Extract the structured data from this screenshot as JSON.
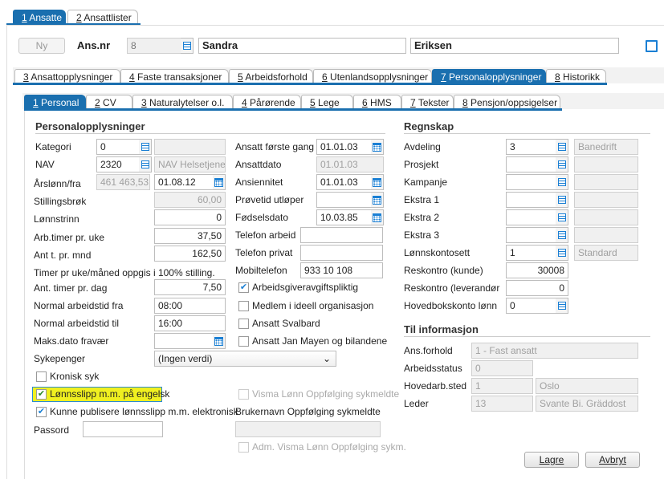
{
  "top_tabs": [
    {
      "num": "1",
      "label": "Ansatte",
      "active": true
    },
    {
      "num": "2",
      "label": "Ansattlister"
    }
  ],
  "header": {
    "new_label": "Ny",
    "ansnr_label": "Ans.nr",
    "ansnr": "8",
    "first_name": "Sandra",
    "last_name": "Eriksen"
  },
  "main_tabs": [
    {
      "num": "3",
      "label": "Ansattopplysninger"
    },
    {
      "num": "4",
      "label": "Faste transaksjoner"
    },
    {
      "num": "5",
      "label": "Arbeidsforhold"
    },
    {
      "num": "6",
      "label": "Utenlandsopplysninger"
    },
    {
      "num": "7",
      "label": "Personalopplysninger",
      "active": true
    },
    {
      "num": "8",
      "label": "Historikk"
    }
  ],
  "sub_tabs": [
    {
      "num": "1",
      "label": "Personal",
      "active": true
    },
    {
      "num": "2",
      "label": "CV"
    },
    {
      "num": "3",
      "label": "Naturalytelser o.l."
    },
    {
      "num": "4",
      "label": "Pårørende"
    },
    {
      "num": "5",
      "label": "Lege"
    },
    {
      "num": "6",
      "label": "HMS"
    },
    {
      "num": "7",
      "label": "Tekster"
    },
    {
      "num": "8",
      "label": "Pensjon/oppsigelser"
    }
  ],
  "personal": {
    "title": "Personalopplysninger",
    "kategori": {
      "label": "Kategori",
      "value": "0",
      "desc": ""
    },
    "nav": {
      "label": "NAV",
      "value": "2320",
      "desc": "NAV Helsetjene"
    },
    "arslonn": {
      "label": "Årslønn/fra",
      "value": "461 463,53",
      "date": "01.08.12"
    },
    "stillingsbrok": {
      "label": "Stillingsbrøk",
      "value": "60,00"
    },
    "lonnstrinn": {
      "label": "Lønnstrinn",
      "value": "0"
    },
    "arbtimer": {
      "label": "Arb.timer pr. uke",
      "value": "37,50"
    },
    "anttmnd": {
      "label": "Ant t. pr. mnd",
      "value": "162,50"
    },
    "note": "Timer pr uke/måned oppgis i 100% stilling.",
    "anttdag": {
      "label": "Ant. timer pr. dag",
      "value": "7,50"
    },
    "fra": {
      "label": "Normal arbeidstid fra",
      "value": "08:00"
    },
    "til": {
      "label": "Normal arbeidstid til",
      "value": "16:00"
    },
    "maks": {
      "label": "Maks.dato fravær",
      "value": ""
    },
    "sykepenger": {
      "label": "Sykepenger",
      "value": "(Ingen verdi)"
    },
    "kronisk": {
      "label": "Kronisk syk",
      "checked": false
    },
    "engelsk": {
      "label": "Lønnsslipp m.m. på engelsk",
      "checked": true
    },
    "publisere": {
      "label": "Kunne publisere lønnsslipp m.m. elektronisk",
      "checked": true
    },
    "passord": {
      "label": "Passord",
      "value": ""
    },
    "forste": {
      "label": "Ansatt første gang",
      "value": "01.01.03"
    },
    "ansattdato": {
      "label": "Ansattdato",
      "value": "01.01.03"
    },
    "ansiennitet": {
      "label": "Ansiennitet",
      "value": "01.01.03"
    },
    "provetid": {
      "label": "Prøvetid utløper",
      "value": ""
    },
    "fodsel": {
      "label": "Fødselsdato",
      "value": "10.03.85"
    },
    "tlfarb": {
      "label": "Telefon arbeid",
      "value": ""
    },
    "tlfpriv": {
      "label": "Telefon privat",
      "value": ""
    },
    "mobil": {
      "label": "Mobiltelefon",
      "value": "933 10 108"
    },
    "aga": {
      "label": "Arbeidsgiveravgiftspliktig",
      "checked": true
    },
    "ideell": {
      "label": "Medlem i ideell organisasjon",
      "checked": false
    },
    "svalbard": {
      "label": "Ansatt Svalbard",
      "checked": false
    },
    "janmayen": {
      "label": "Ansatt Jan Mayen og bilandene",
      "checked": false
    },
    "visma": {
      "label": "Visma Lønn Oppfølging sykmeldte",
      "checked": false
    },
    "brukernavn": {
      "label": "Brukernavn Oppfølging sykmeldte",
      "value": ""
    },
    "adm": {
      "label": "Adm. Visma Lønn Oppfølging sykm.",
      "checked": false
    }
  },
  "regnskap": {
    "title": "Regnskap",
    "rows": [
      {
        "label": "Avdeling",
        "value": "3",
        "desc": "Banedrift"
      },
      {
        "label": "Prosjekt",
        "value": "",
        "desc": ""
      },
      {
        "label": "Kampanje",
        "value": "",
        "desc": ""
      },
      {
        "label": "Ekstra 1",
        "value": "",
        "desc": ""
      },
      {
        "label": "Ekstra 2",
        "value": "",
        "desc": ""
      },
      {
        "label": "Ekstra 3",
        "value": "",
        "desc": ""
      },
      {
        "label": "Lønnskontosett",
        "value": "1",
        "desc": "Standard"
      }
    ],
    "kunde": {
      "label": "Reskontro (kunde)",
      "value": "30008"
    },
    "leverandor": {
      "label": "Reskontro (leverandør",
      "value": "0"
    },
    "hovedbok": {
      "label": "Hovedbokskonto lønn",
      "value": "0"
    }
  },
  "info": {
    "title": "Til informasjon",
    "ansforhold": {
      "label": "Ans.forhold",
      "value": "1 - Fast ansatt"
    },
    "arbstatus": {
      "label": "Arbeidsstatus",
      "value": "0"
    },
    "hovedarb": {
      "label": "Hovedarb.sted",
      "value": "1",
      "desc": "Oslo"
    },
    "leder": {
      "label": "Leder",
      "value": "13",
      "desc": "Svante Bi. Gräddost"
    }
  },
  "buttons": {
    "save": "Lagre",
    "cancel": "Avbryt"
  },
  "colors": {
    "accent": "#1a6faf",
    "highlight": "#f0f020"
  }
}
